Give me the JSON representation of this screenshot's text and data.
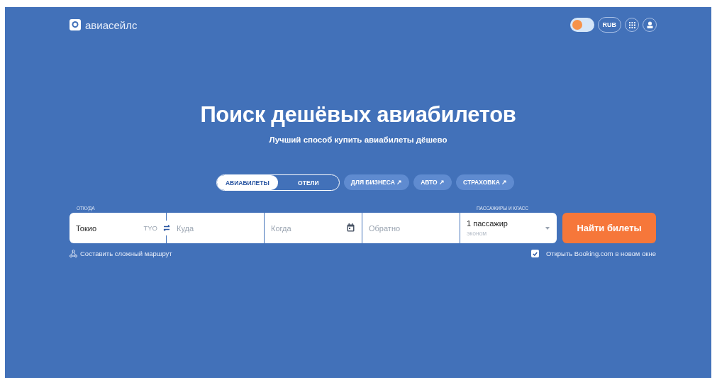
{
  "header": {
    "logo": "авиасейлс",
    "currency": "RUB"
  },
  "hero": {
    "title": "Поиск дешёвых авиабилетов",
    "subtitle": "Лучший способ купить авиабилеты дёшево"
  },
  "tabs": [
    {
      "label": "АВИАБИЛЕТЫ",
      "selected": true,
      "kind": "segment"
    },
    {
      "label": "ОТЕЛИ",
      "selected": false,
      "kind": "segment"
    },
    {
      "label": "ДЛЯ БИЗНЕСА ↗",
      "selected": false,
      "kind": "link"
    },
    {
      "label": "АВТО ↗",
      "selected": false,
      "kind": "link"
    },
    {
      "label": "СТРАХОВКА ↗",
      "selected": false,
      "kind": "link"
    }
  ],
  "search": {
    "origin": {
      "label": "ОТКУДА",
      "value": "Токио",
      "code": "TYO"
    },
    "destination": {
      "placeholder": "Куда"
    },
    "date": {
      "placeholder": "Когда"
    },
    "return_date": {
      "placeholder": "Обратно"
    },
    "passengers": {
      "label": "ПАССАЖИРЫ И КЛАСС",
      "value": "1 пассажир",
      "class": "эконом"
    },
    "submit": "Найти билеты",
    "complex_route": "Составить сложный маршрут",
    "booking_checkbox": {
      "label": "Открыть Booking.com в новом окне",
      "checked": true
    }
  }
}
